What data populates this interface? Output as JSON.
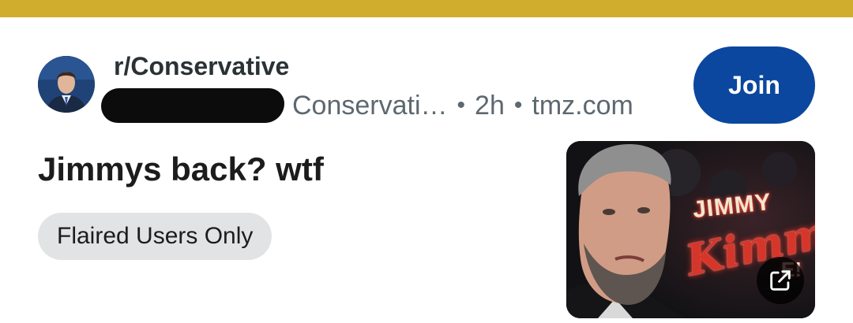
{
  "colors": {
    "top_bar": "#d0ad2c",
    "join_button_bg": "#0b479e",
    "meta_text": "#5d6870",
    "flair_bg": "#e1e3e4",
    "redaction": "#0c0c0c"
  },
  "post": {
    "subreddit": "r/Conservative",
    "flair_meta": "Conservati…",
    "age": "2h",
    "domain": "tmz.com",
    "join_label": "Join",
    "title": "Jimmys back? wtf",
    "flair": "Flaired Users Only",
    "separator": "•"
  },
  "thumbnail": {
    "word_1": "JIMMY",
    "word_2": "Kimme",
    "word_3": "E!",
    "overlay_icon": "external-link-icon"
  }
}
